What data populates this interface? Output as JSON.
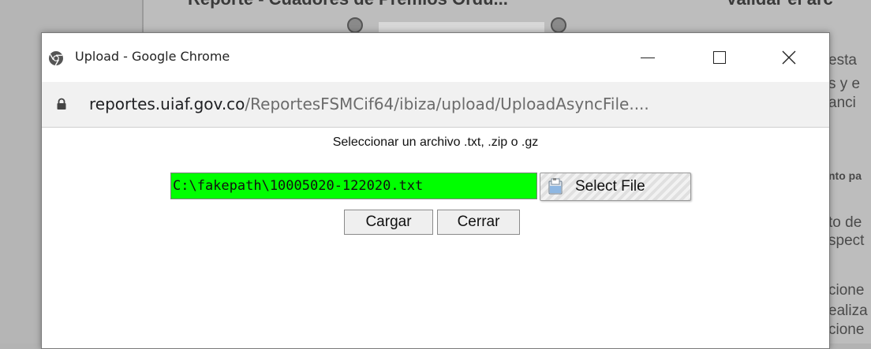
{
  "background": {
    "title_left": "Reporte - Cuadores de Premios Ordu...",
    "title_right": "Validar el arc",
    "side_text": [
      "esta",
      "s y e",
      "anci",
      "nto pa",
      "to de",
      "spect",
      "cione",
      "ealiza",
      "cione"
    ]
  },
  "window": {
    "title": "Upload - Google Chrome",
    "controls": {
      "minimize": "—",
      "maximize": "☐",
      "close": "✕"
    },
    "url_host": "reportes.uiaf.gov.co",
    "url_path": "/ReportesFSMCif64/ibiza/upload/UploadAsyncFile...."
  },
  "upload": {
    "heading": "Seleccionar un archivo .txt, .zip o .gz",
    "file_value": "C:\\fakepath\\10005020-122020.txt",
    "select_label": "Select File",
    "cargar_label": "Cargar",
    "cerrar_label": "Cerrar"
  },
  "colors": {
    "file_field_bg": "#00ff00",
    "page_overlay": "#bdbdbd"
  },
  "icons": {
    "app": "chrome-icon",
    "lock": "lock-icon",
    "select": "file-folder-icon"
  }
}
